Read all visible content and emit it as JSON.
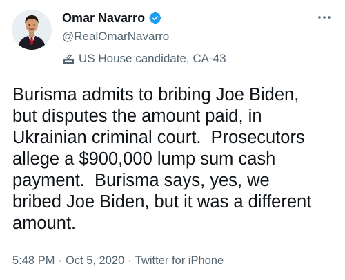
{
  "author": {
    "display_name": "Omar Navarro",
    "handle": "@RealOmarNavarro",
    "verified": true,
    "label": "US House candidate, CA-43",
    "avatar_icon": "profile-photo"
  },
  "tweet": {
    "text": "Burisma admits to bribing Joe Biden,\nbut disputes the amount paid, in\nUkrainian criminal court.  Prosecutors\nallege a $900,000 lump sum cash\npayment.  Burisma says, yes, we\nbribed Joe Biden, but it was a different\namount."
  },
  "meta": {
    "time": "5:48 PM",
    "separator": "·",
    "date": "Oct 5, 2020",
    "source": "Twitter for iPhone"
  },
  "icons": {
    "verified": "verified-badge-icon",
    "label": "ballot-box-icon",
    "more": "more-options-icon"
  },
  "colors": {
    "text": "#0f1419",
    "secondary": "#536471",
    "verified_blue": "#1d9bf0"
  }
}
